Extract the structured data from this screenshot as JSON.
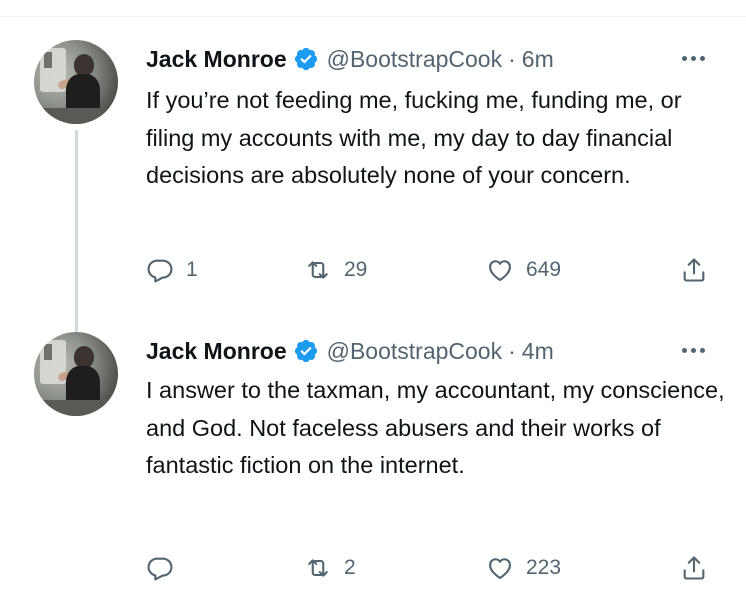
{
  "tweets": [
    {
      "name": "Jack Monroe",
      "handle": "@BootstrapCook",
      "separator": "·",
      "time": "6m",
      "text": "If you’re not feeding me, fucking me, funding me, or filing my accounts with me, my day to day financial decisions are absolutely none of your concern.",
      "replies": "1",
      "retweets": "29",
      "likes": "649"
    },
    {
      "name": "Jack Monroe",
      "handle": "@BootstrapCook",
      "separator": "·",
      "time": "4m",
      "text": "I answer to the taxman, my accountant, my conscience, and God. Not faceless abusers and their works of fantastic fiction on the internet.",
      "replies": "",
      "retweets": "2",
      "likes": "223"
    }
  ],
  "icons": {
    "verified": "verified-badge-icon",
    "more": "more-dots-icon",
    "reply": "reply-icon",
    "retweet": "retweet-icon",
    "like": "like-heart-icon",
    "share": "share-icon"
  },
  "colors": {
    "verified": "#1d9bf0",
    "secondary_text": "#536471",
    "thread_line": "#cfd9de"
  }
}
